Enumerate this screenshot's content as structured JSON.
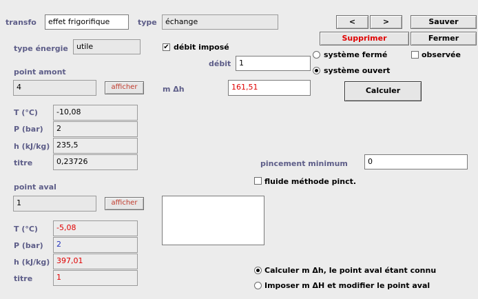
{
  "top": {
    "transfo_label": "transfo",
    "transfo_value": "effet frigorifique",
    "type_label": "type",
    "type_value": "échange"
  },
  "buttons": {
    "prev": "<",
    "next": ">",
    "save": "Sauver",
    "delete": "Supprimer",
    "close": "Fermer",
    "calculate": "Calculer"
  },
  "energy": {
    "type_label": "type énergie",
    "type_value": "utile",
    "debit_impose_label": "débit imposé",
    "debit_impose_checked": "✔",
    "debit_label": "débit",
    "debit_value": "1",
    "mdh_label": "m Δh",
    "mdh_value": "161,51"
  },
  "system": {
    "ferme_label": "système fermé",
    "ouvert_label": "système ouvert",
    "observee_label": "observée"
  },
  "amont": {
    "title": "point amont",
    "point": "4",
    "show_button": "afficher",
    "rows": [
      {
        "label": "T (°C)",
        "value": "-10,08"
      },
      {
        "label": "P (bar)",
        "value": "2"
      },
      {
        "label": "h (kJ/kg)",
        "value": "235,5"
      },
      {
        "label": "titre",
        "value": "0,23726"
      }
    ]
  },
  "aval": {
    "title": "point aval",
    "point": "1",
    "show_button": "afficher",
    "rows": [
      {
        "label": "T (°C)",
        "value": "-5,08"
      },
      {
        "label": "P (bar)",
        "value": "2"
      },
      {
        "label": "h (kJ/kg)",
        "value": "397,01"
      },
      {
        "label": "titre",
        "value": "1"
      }
    ]
  },
  "pincement": {
    "label": "pincement minimum",
    "value": "0",
    "fluide_label": "fluide méthode pinct."
  },
  "mode": {
    "option1": "Calculer m Δh, le point aval étant connu",
    "option2": "Imposer m ΔH et modifier le point aval"
  }
}
